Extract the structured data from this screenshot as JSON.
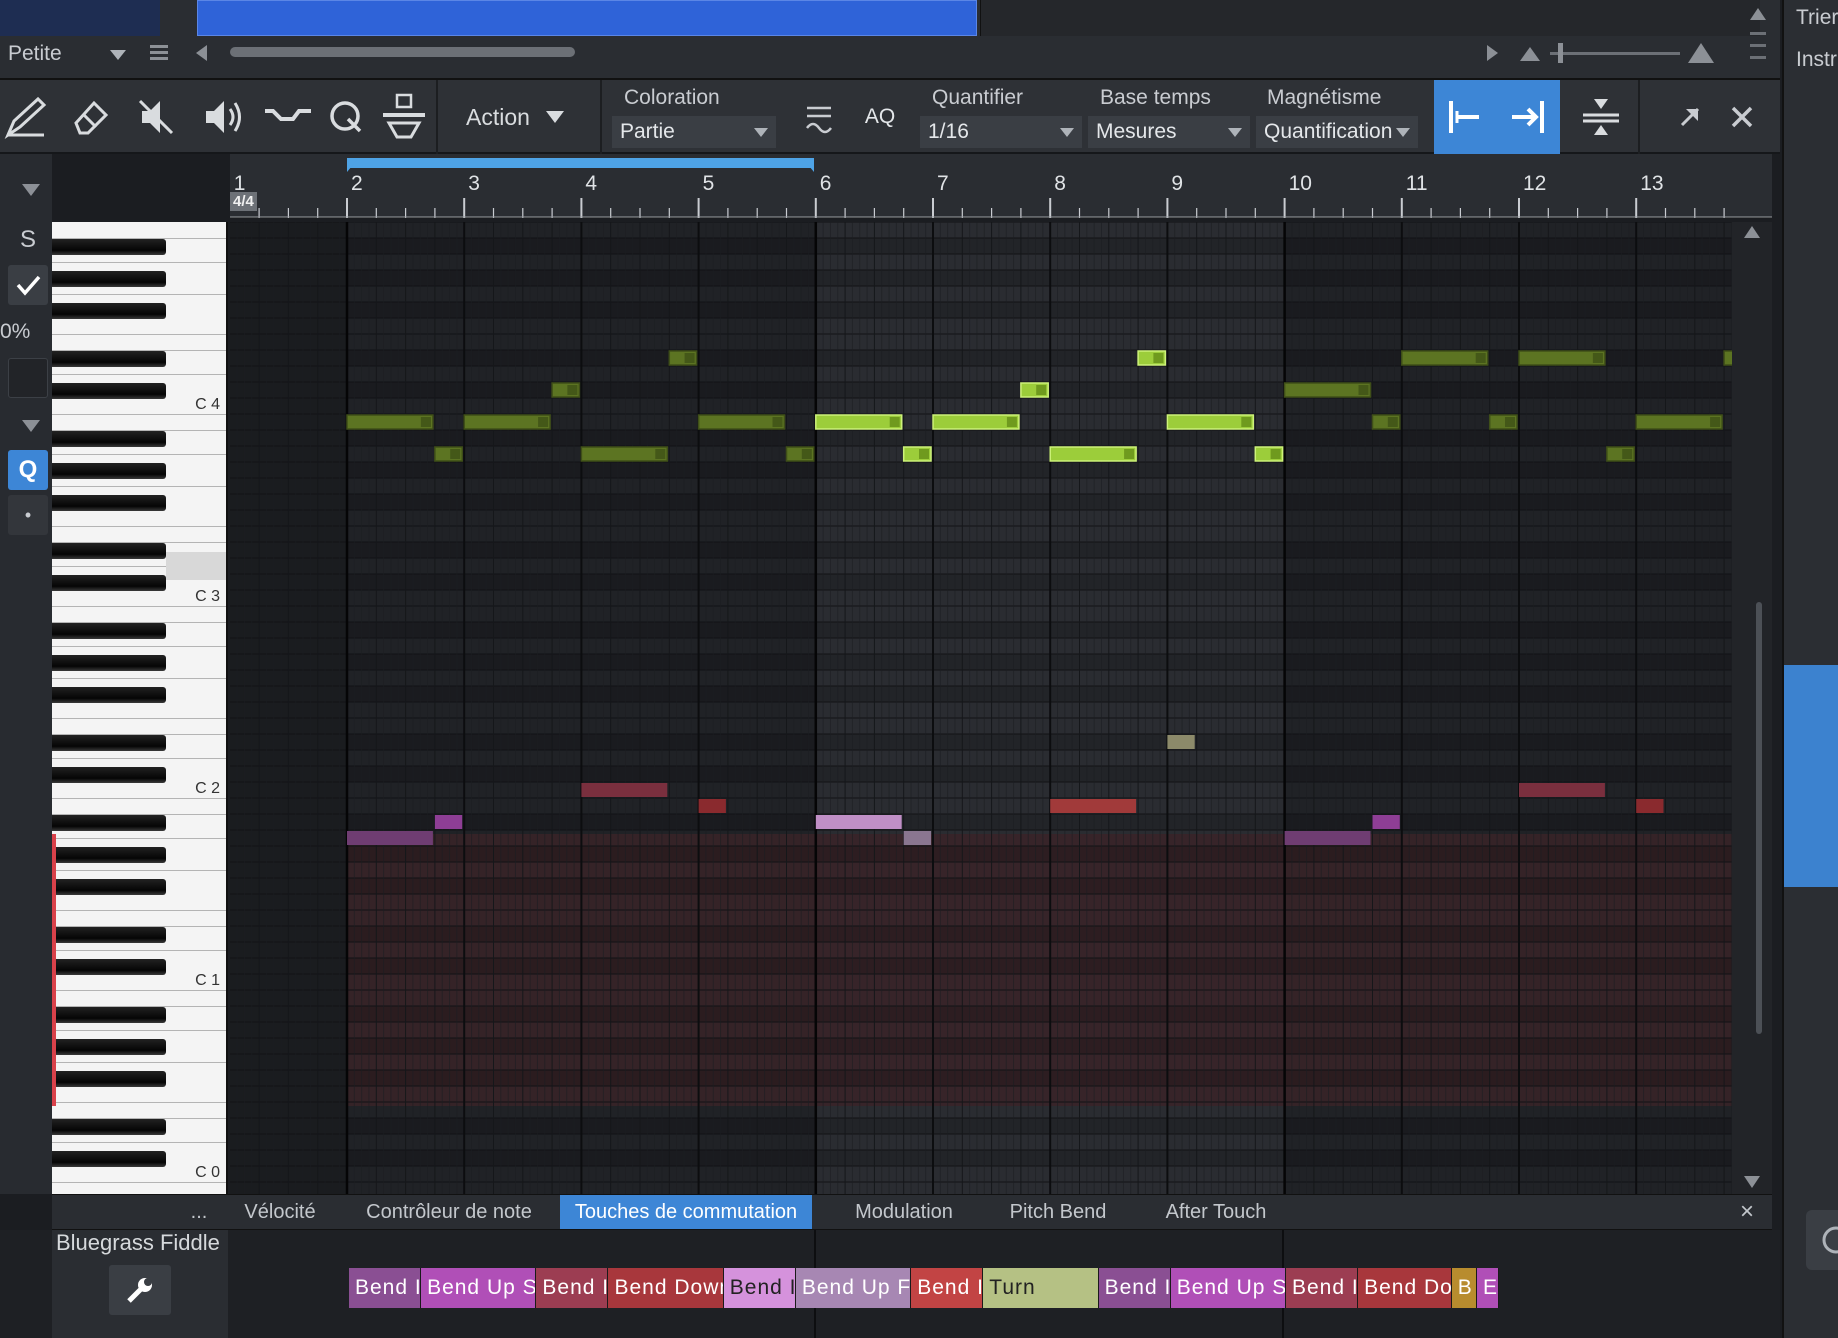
{
  "top": {
    "zoom_label": "Petite"
  },
  "right_panel": {
    "label_1": "Trier",
    "label_2": "Instr"
  },
  "toolbar": {
    "action_label": "Action",
    "coloration_label": "Coloration",
    "coloration_value": "Partie",
    "aq_label": "AQ",
    "quantize_label": "Quantifier",
    "quantize_value": "1/16",
    "timebase_label": "Base temps",
    "timebase_value": "Mesures",
    "snap_label": "Magnétisme",
    "snap_value": "Quantification"
  },
  "ruler": {
    "time_signature": "4/4",
    "bars": [
      "1",
      "2",
      "3",
      "4",
      "5",
      "6",
      "7",
      "8",
      "9",
      "10",
      "11",
      "12",
      "13"
    ]
  },
  "left_column": {
    "solo_label": "S",
    "percent_label": "0%",
    "q_label": "Q",
    "dot_label": "•"
  },
  "keyboard": {
    "octave_labels": [
      "C 4",
      "C 3",
      "C 2",
      "C 1",
      "C 0"
    ]
  },
  "notes": [
    {
      "bar": 2,
      "beat": 1,
      "len_beats": 3,
      "row": "E3",
      "shade": "dim"
    },
    {
      "bar": 2,
      "beat": 4,
      "len_beats": 1,
      "row": "D3",
      "shade": "dim"
    },
    {
      "bar": 3,
      "beat": 1,
      "len_beats": 3,
      "row": "E3",
      "shade": "dim"
    },
    {
      "bar": 3,
      "beat": 4,
      "len_beats": 1,
      "row": "F#3",
      "shade": "dim"
    },
    {
      "bar": 4,
      "beat": 1,
      "len_beats": 3,
      "row": "D3",
      "shade": "dim"
    },
    {
      "bar": 4,
      "beat": 4,
      "len_beats": 1,
      "row": "G#3",
      "shade": "dim"
    },
    {
      "bar": 5,
      "beat": 1,
      "len_beats": 3,
      "row": "E3",
      "shade": "dim"
    },
    {
      "bar": 5,
      "beat": 4,
      "len_beats": 1,
      "row": "D3",
      "shade": "dim"
    },
    {
      "bar": 6,
      "beat": 1,
      "len_beats": 3,
      "row": "E3",
      "shade": "bright"
    },
    {
      "bar": 6,
      "beat": 4,
      "len_beats": 1,
      "row": "D3",
      "shade": "bright"
    },
    {
      "bar": 7,
      "beat": 1,
      "len_beats": 3,
      "row": "E3",
      "shade": "bright"
    },
    {
      "bar": 7,
      "beat": 4,
      "len_beats": 1,
      "row": "F#3",
      "shade": "bright"
    },
    {
      "bar": 8,
      "beat": 1,
      "len_beats": 3,
      "row": "D3",
      "shade": "bright"
    },
    {
      "bar": 8,
      "beat": 4,
      "len_beats": 1,
      "row": "G#3",
      "shade": "bright"
    },
    {
      "bar": 9,
      "beat": 1,
      "len_beats": 3,
      "row": "E3",
      "shade": "bright"
    },
    {
      "bar": 9,
      "beat": 4,
      "len_beats": 1,
      "row": "D3",
      "shade": "bright"
    },
    {
      "bar": 10,
      "beat": 1,
      "len_beats": 3,
      "row": "F#3",
      "shade": "dim"
    },
    {
      "bar": 10,
      "beat": 4,
      "len_beats": 1,
      "row": "E3",
      "shade": "dim"
    },
    {
      "bar": 11,
      "beat": 1,
      "len_beats": 3,
      "row": "G#3",
      "shade": "dim"
    },
    {
      "bar": 11,
      "beat": 4,
      "len_beats": 1,
      "row": "E3",
      "shade": "dim"
    },
    {
      "bar": 12,
      "beat": 1,
      "len_beats": 3,
      "row": "G#3",
      "shade": "dim"
    },
    {
      "bar": 12,
      "beat": 4,
      "len_beats": 1,
      "row": "D3",
      "shade": "dim"
    },
    {
      "bar": 13,
      "beat": 1,
      "len_beats": 3,
      "row": "E3",
      "shade": "dim"
    },
    {
      "bar": 13,
      "beat": 4,
      "len_beats": 1,
      "row": "G#3",
      "shade": "dim"
    }
  ],
  "tabs": {
    "more": "...",
    "items": [
      "Vélocité",
      "Contrôleur de note",
      "Touches de commutation",
      "Modulation",
      "Pitch Bend",
      "After Touch"
    ],
    "active": "Touches de commutation",
    "close": "×"
  },
  "lane": {
    "instrument": "Bluegrass Fiddle",
    "keyswitches": [
      {
        "text": "Bend I",
        "color": "#8a4f93"
      },
      {
        "text": "Bend Up Sl",
        "color": "#b04fb7"
      },
      {
        "text": "Bend I",
        "color": "#9c3d52"
      },
      {
        "text": "Bend Down",
        "color": "#a8373c"
      },
      {
        "text": "Bend I",
        "color": "#d592dc"
      },
      {
        "text": "Bend Up Fa",
        "color": "#a787b3"
      },
      {
        "text": "Bend I",
        "color": "#c24444"
      },
      {
        "text": "Turn",
        "color": "#b5c184"
      },
      {
        "text": "Bend I",
        "color": "#8a4f93"
      },
      {
        "text": "Bend Up Sl",
        "color": "#b04fb7"
      },
      {
        "text": "Bend I",
        "color": "#9c3d52"
      },
      {
        "text": "Bend Do",
        "color": "#a8373c"
      },
      {
        "text": "B",
        "color": "#b88c2e"
      },
      {
        "text": "E",
        "color": "#b04fb7"
      }
    ]
  },
  "colors": {
    "accent": "#3d86d6",
    "note_dim": "#5c7422",
    "note_bright": "#9ccd3a",
    "keyswitch_zone": "#3a2328"
  }
}
